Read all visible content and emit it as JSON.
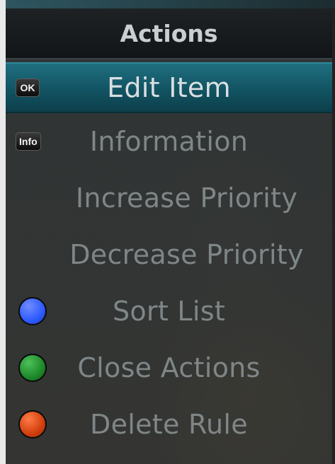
{
  "header": {
    "title": "Actions"
  },
  "menu": {
    "items": [
      {
        "label": "Edit Item",
        "key": "OK",
        "selected": true
      },
      {
        "label": "Information",
        "key": "Info"
      },
      {
        "label": "Increase Priority"
      },
      {
        "label": "Decrease Priority"
      },
      {
        "label": "Sort List",
        "color_key": "blue",
        "color": "#2f5bff"
      },
      {
        "label": "Close Actions",
        "color_key": "green",
        "color": "#1e8a2a"
      },
      {
        "label": "Delete Rule",
        "color_key": "red",
        "color": "#d2400e"
      }
    ]
  },
  "colors": {
    "selected_bar": "#125362",
    "header_bg": "#121517"
  }
}
